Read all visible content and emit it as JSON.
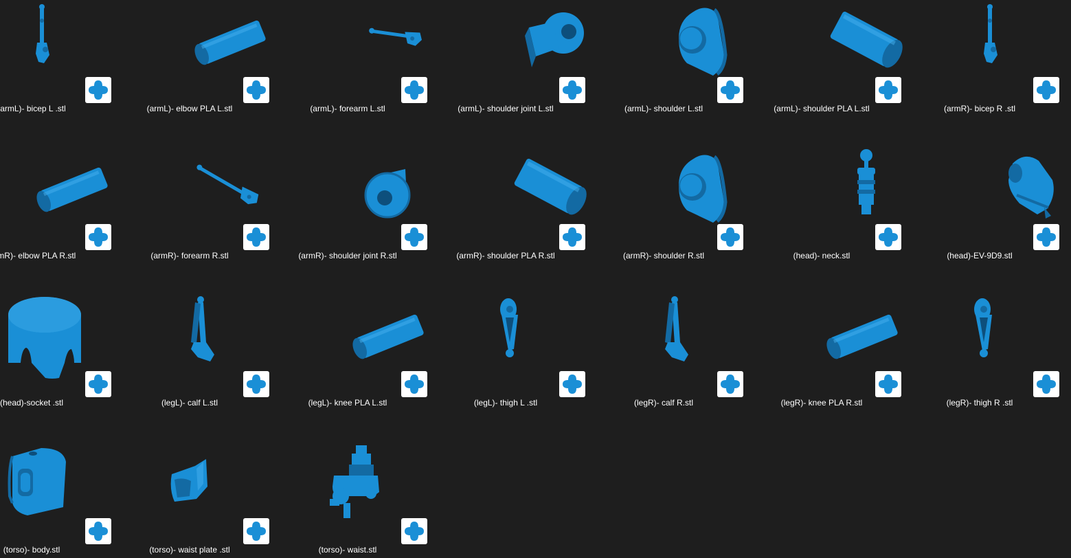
{
  "colors": {
    "background": "#1e1e1e",
    "model_blue": "#1a8fd6",
    "badge_background": "#ffffff",
    "label_text": "#ffffff"
  },
  "badge_icon": "slicer-app-icon",
  "files": [
    {
      "name": "(armL)- bicep L .stl",
      "shape": "chain-vertical"
    },
    {
      "name": "(armL)- elbow PLA L.stl",
      "shape": "cylinder"
    },
    {
      "name": "(armL)- forearm L.stl",
      "shape": "chain-horizontal"
    },
    {
      "name": "(armL)- shoulder joint L.stl",
      "shape": "joint-block"
    },
    {
      "name": "(armL)- shoulder L.stl",
      "shape": "shoulder-dome"
    },
    {
      "name": "(armL)- shoulder PLA L.stl",
      "shape": "cylinder-large"
    },
    {
      "name": "(armR)- bicep R .stl",
      "shape": "chain-vertical"
    },
    {
      "name": "(armR)- elbow PLA R.stl",
      "shape": "cylinder"
    },
    {
      "name": "(armR)- forearm R.stl",
      "shape": "chain-diagonal"
    },
    {
      "name": "(armR)- shoulder joint R.stl",
      "shape": "joint-ring"
    },
    {
      "name": "(armR)- shoulder PLA R.stl",
      "shape": "cylinder-large"
    },
    {
      "name": "(armR)- shoulder R.stl",
      "shape": "shoulder-dome"
    },
    {
      "name": "(head)- neck.stl",
      "shape": "neck"
    },
    {
      "name": "(head)-EV-9D9.stl",
      "shape": "head"
    },
    {
      "name": "(head)-socket .stl",
      "shape": "socket"
    },
    {
      "name": "(legL)- calf L.stl",
      "shape": "leg"
    },
    {
      "name": "(legL)- knee PLA L.stl",
      "shape": "cylinder"
    },
    {
      "name": "(legL)- thigh L .stl",
      "shape": "thigh"
    },
    {
      "name": "(legR)- calf R.stl",
      "shape": "leg"
    },
    {
      "name": "(legR)- knee PLA R.stl",
      "shape": "cylinder"
    },
    {
      "name": "(legR)- thigh R .stl",
      "shape": "thigh"
    },
    {
      "name": "(torso)- body.stl",
      "shape": "body"
    },
    {
      "name": "(torso)- waist plate .stl",
      "shape": "waist-plate"
    },
    {
      "name": "(torso)- waist.stl",
      "shape": "waist"
    }
  ]
}
